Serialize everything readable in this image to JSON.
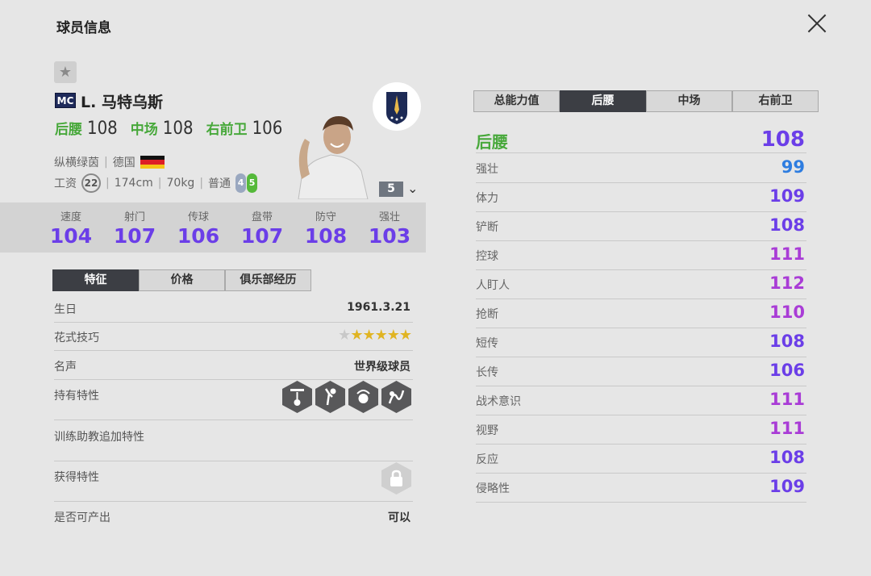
{
  "header": {
    "title": "球员信息"
  },
  "player": {
    "position_badge": "MC",
    "name": "L. 马特乌斯",
    "positions": [
      {
        "name": "后腰",
        "value": "108"
      },
      {
        "name": "中场",
        "value": "108"
      },
      {
        "name": "右前卫",
        "value": "106"
      }
    ],
    "club": "纵横绿茵",
    "nation": "德国",
    "salary_label": "工资",
    "salary": "22",
    "height": "174cm",
    "weight": "70kg",
    "body_type": "普通",
    "weak_foot": "4",
    "strong_foot": "5",
    "level": "5"
  },
  "main_stats": [
    {
      "label": "速度",
      "value": "104"
    },
    {
      "label": "射门",
      "value": "107"
    },
    {
      "label": "传球",
      "value": "106"
    },
    {
      "label": "盘带",
      "value": "107"
    },
    {
      "label": "防守",
      "value": "108"
    },
    {
      "label": "强壮",
      "value": "103"
    }
  ],
  "left_tabs": [
    "特征",
    "价格",
    "俱乐部经历"
  ],
  "traits": {
    "birthday_label": "生日",
    "birthday": "1961.3.21",
    "skill_label": "花式技巧",
    "skill_stars": 5,
    "skill_max": 6,
    "fame_label": "名声",
    "fame": "世界级球员",
    "held_traits_label": "持有特性",
    "held_traits_icons": [
      "long-shot-icon",
      "power-header-icon",
      "power-kick-icon",
      "dribble-run-icon"
    ],
    "coach_traits_label": "训练助教追加特性",
    "acquired_traits_label": "获得特性",
    "producible_label": "是否可产出",
    "producible": "可以"
  },
  "right_tabs": [
    "总能力值",
    "后腰",
    "中场",
    "右前卫"
  ],
  "attributes": {
    "head_label": "后腰",
    "head_value": "108",
    "rows": [
      {
        "label": "强壮",
        "value": "99",
        "color": "#2e7de0"
      },
      {
        "label": "体力",
        "value": "109",
        "color": "#6b3ee8"
      },
      {
        "label": "铲断",
        "value": "108",
        "color": "#6b3ee8"
      },
      {
        "label": "控球",
        "value": "111",
        "color": "#a93cd6"
      },
      {
        "label": "人盯人",
        "value": "112",
        "color": "#a93cd6"
      },
      {
        "label": "抢断",
        "value": "110",
        "color": "#a93cd6"
      },
      {
        "label": "短传",
        "value": "108",
        "color": "#6b3ee8"
      },
      {
        "label": "长传",
        "value": "106",
        "color": "#6b3ee8"
      },
      {
        "label": "战术意识",
        "value": "111",
        "color": "#a93cd6"
      },
      {
        "label": "视野",
        "value": "111",
        "color": "#a93cd6"
      },
      {
        "label": "反应",
        "value": "108",
        "color": "#6b3ee8"
      },
      {
        "label": "侵略性",
        "value": "109",
        "color": "#6b3ee8"
      }
    ]
  },
  "colors": {
    "accent_green": "#47a83a",
    "stat_purple": "#6b3ee8",
    "stat_violet": "#a93cd6",
    "stat_blue": "#2e7de0"
  }
}
